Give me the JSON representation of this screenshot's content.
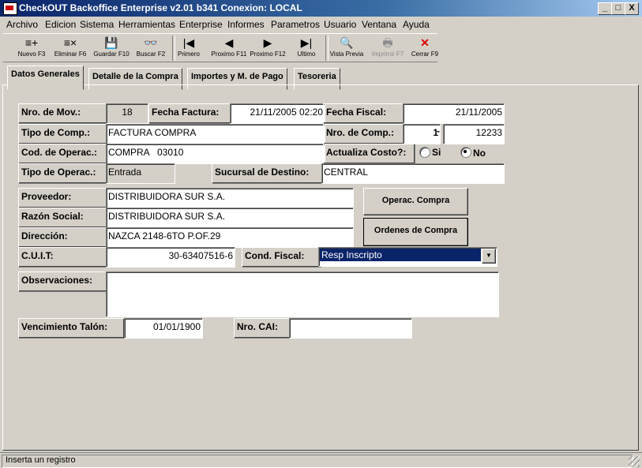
{
  "window": {
    "title": "CheckOUT Backoffice Enterprise v2.01 b341 Conexion: LOCAL",
    "controls": {
      "minimize": "_",
      "restore": "□",
      "close": "X"
    }
  },
  "menubar": [
    "Archivo",
    "Edicion",
    "Sistema",
    "Herramientas",
    "Enterprise",
    "Informes",
    "Parametros",
    "Usuario",
    "Ventana",
    "Ayuda"
  ],
  "toolbar": [
    {
      "label": "Nuevo F3",
      "icon": "≡+",
      "enabled": true
    },
    {
      "label": "Eliminar F6",
      "icon": "≡×",
      "enabled": true
    },
    {
      "label": "Guardar F10",
      "icon": "💾",
      "enabled": true
    },
    {
      "label": "Buscar F2",
      "icon": "👓",
      "enabled": true
    },
    {
      "label": "Primero",
      "icon": "|◀",
      "enabled": true
    },
    {
      "label": "Proximo F11",
      "icon": "◀",
      "enabled": true
    },
    {
      "label": "Proximo F12",
      "icon": "▶",
      "enabled": true
    },
    {
      "label": "Ultimo",
      "icon": "▶|",
      "enabled": true
    },
    {
      "label": "Vista Previa",
      "icon": "🔍",
      "enabled": true
    },
    {
      "label": "Imprimir F7",
      "icon": "🖶",
      "enabled": false
    },
    {
      "label": "Cerrar F9",
      "icon": "✕",
      "enabled": true
    }
  ],
  "tabs": [
    "Datos Generales",
    "Detalle de la Compra",
    "Importes y M. de Pago",
    "Tesoreria"
  ],
  "form": {
    "nro_mov": {
      "label": "Nro. de Mov.:",
      "value": "18"
    },
    "fecha_factura": {
      "label": "Fecha Factura:",
      "value": "21/11/2005 02:20"
    },
    "fecha_fiscal": {
      "label": "Fecha Fiscal:",
      "value": "21/11/2005"
    },
    "tipo_comp": {
      "label": "Tipo de Comp.:",
      "value": "FACTURA COMPRA"
    },
    "nro_comp": {
      "label": "Nro. de Comp.:",
      "value1": "1",
      "sep": "-",
      "value2": "12233"
    },
    "cod_operac": {
      "label": "Cod. de Operac.:",
      "value": "COMPRA   03010"
    },
    "actualiza_costo": {
      "label": "Actualiza Costo?:",
      "opt_si": "Si",
      "opt_no": "No",
      "selected": "No"
    },
    "tipo_operac": {
      "label": "Tipo de Operac.:",
      "value": "Entrada"
    },
    "sucursal_destino": {
      "label": "Sucursal de Destino:",
      "value": "CENTRAL"
    },
    "proveedor": {
      "label": "Proveedor:",
      "value": "DISTRIBUIDORA SUR S.A."
    },
    "razon_social": {
      "label": "Razón Social:",
      "value": "DISTRIBUIDORA SUR S.A."
    },
    "direccion": {
      "label": "Dirección:",
      "value": "NAZCA 2148-6TO P.OF.29"
    },
    "cuit": {
      "label": "C.U.I.T:",
      "value": "30-63407516-6"
    },
    "cond_fiscal": {
      "label": "Cond. Fiscal:",
      "value": "Resp Inscripto"
    },
    "observaciones": {
      "label": "Observaciones:",
      "value": ""
    },
    "vencimiento_talon": {
      "label": "Vencimiento Talón:",
      "value": "01/01/1900"
    },
    "nro_cai": {
      "label": "Nro. CAI:",
      "value": ""
    }
  },
  "buttons": {
    "operac_compra": "Operac. Compra",
    "ordenes_compra": "Ordenes de Compra"
  },
  "status": "Inserta un registro",
  "colors": {
    "titlebar": "#0a246a",
    "selection": "#0a246a",
    "face": "#d4d0c8"
  }
}
